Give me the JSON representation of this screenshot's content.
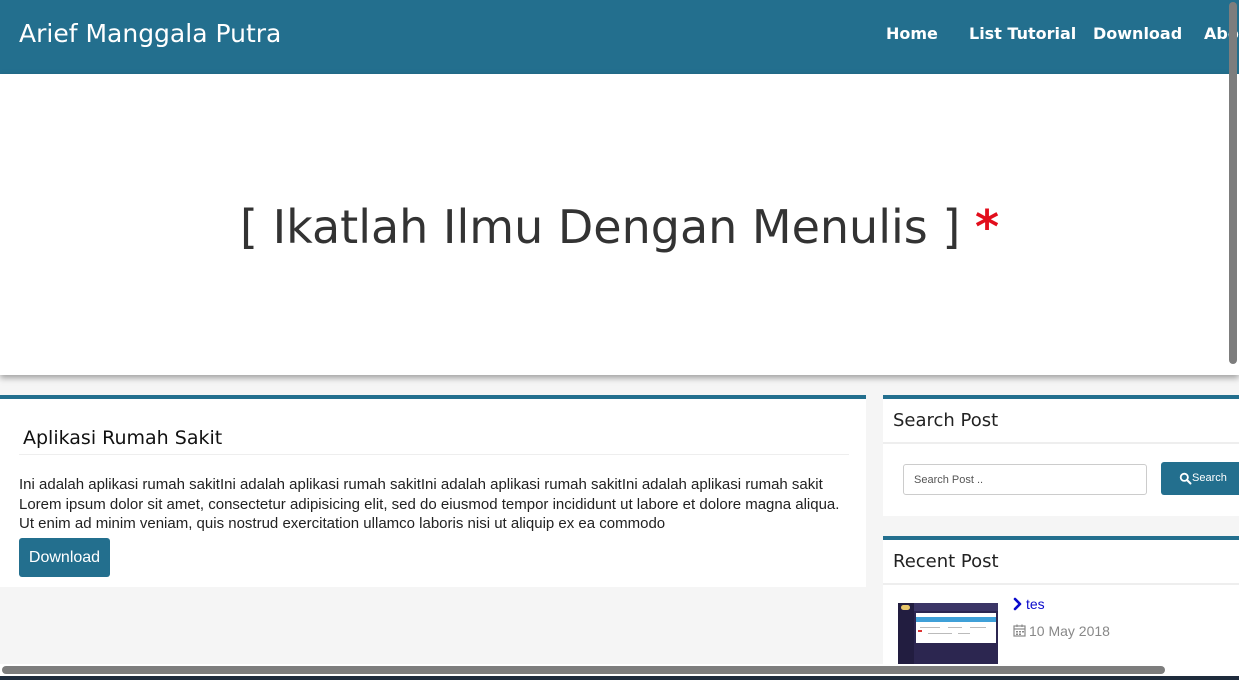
{
  "navbar": {
    "brand": "Arief Manggala Putra",
    "items": [
      {
        "label": "Home"
      },
      {
        "label": "List Tutorial"
      },
      {
        "label": "Download"
      },
      {
        "label": "About"
      }
    ]
  },
  "hero": {
    "title": "[ Ikatlah Ilmu Dengan Menulis ]",
    "star": "*"
  },
  "post": {
    "title": "Aplikasi Rumah Sakit",
    "body": "Ini adalah aplikasi rumah sakitIni adalah aplikasi rumah sakitIni adalah aplikasi rumah sakitIni adalah aplikasi rumah sakit Lorem ipsum dolor sit amet, consectetur adipisicing elit, sed do eiusmod tempor incididunt ut labore et dolore magna aliqua. Ut enim ad minim veniam, quis nostrud exercitation ullamco laboris nisi ut aliquip ex ea commodo",
    "download_label": "Download"
  },
  "search_panel": {
    "heading": "Search Post",
    "placeholder": "Search Post ..",
    "button_label": "Search"
  },
  "recent_panel": {
    "heading": "Recent Post",
    "items": [
      {
        "title": "tes",
        "date": "10 May 2018"
      }
    ]
  },
  "colors": {
    "primary": "#236f8e",
    "accent_star": "#e20e1c",
    "link": "#0a0acc"
  }
}
